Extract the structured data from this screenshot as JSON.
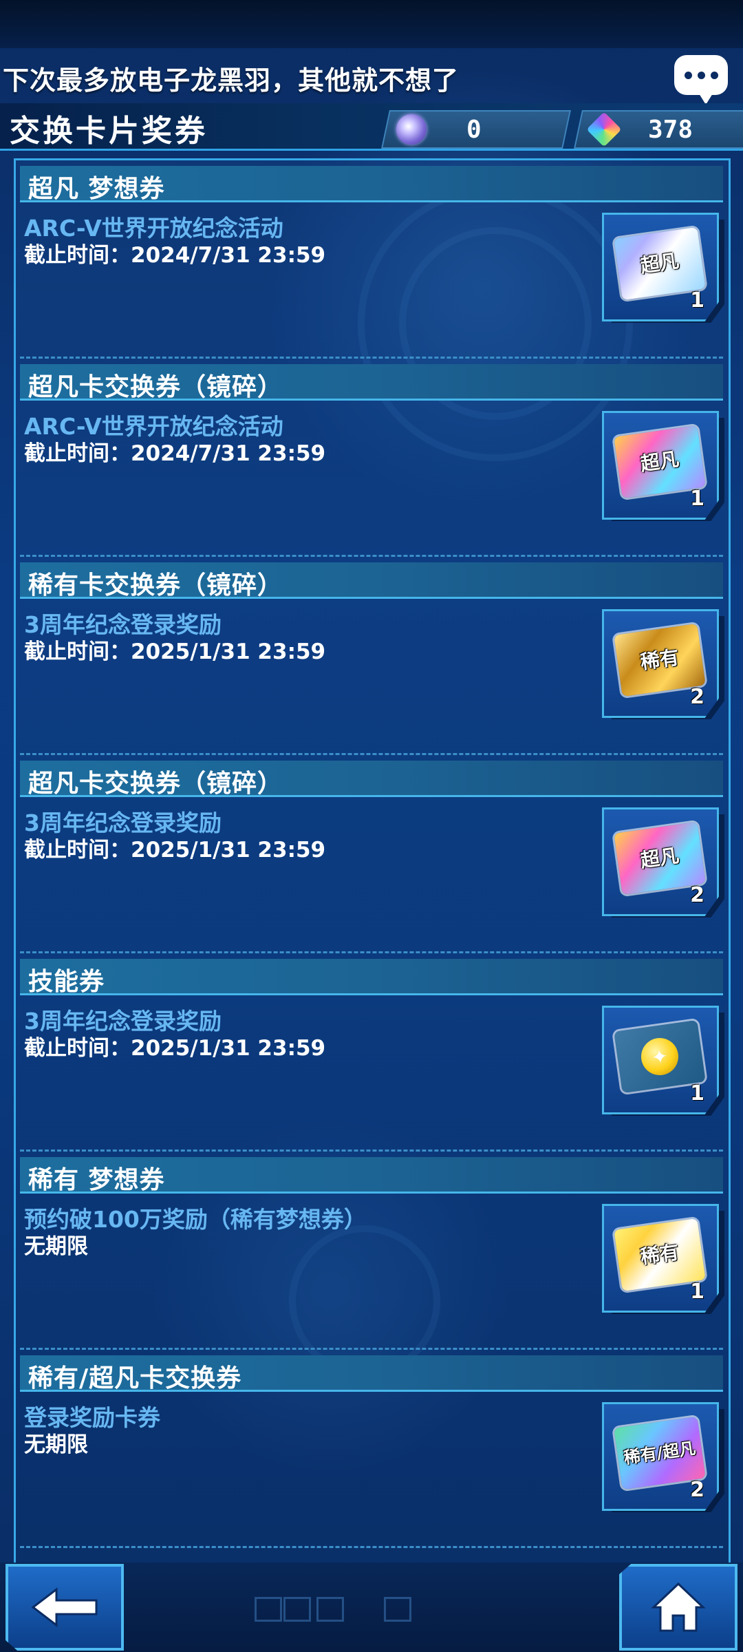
{
  "banner": {
    "text": "下次最多放电子龙黑羽，其他就不想了"
  },
  "header": {
    "title": "交换卡片奖券",
    "currencies": [
      {
        "icon": "orb-icon",
        "value": "0"
      },
      {
        "icon": "gem-icon",
        "value": "378"
      }
    ]
  },
  "tickets": [
    {
      "title": "超凡 梦想券",
      "event": "ARC-V世界开放纪念活动",
      "deadline": "截止时间：2024/7/31 23:59",
      "art_label": "超凡",
      "count": "1",
      "art": "dream"
    },
    {
      "title": "超凡卡交换券（镜碎）",
      "event": "ARC-V世界开放纪念活动",
      "deadline": "截止时间：2024/7/31 23:59",
      "art_label": "超凡",
      "count": "1",
      "art": "ultra"
    },
    {
      "title": "稀有卡交换券（镜碎）",
      "event": "3周年纪念登录奖励",
      "deadline": "截止时间：2025/1/31 23:59",
      "art_label": "稀有",
      "count": "2",
      "art": "rare"
    },
    {
      "title": "超凡卡交换券（镜碎）",
      "event": "3周年纪念登录奖励",
      "deadline": "截止时间：2025/1/31 23:59",
      "art_label": "超凡",
      "count": "2",
      "art": "ultra"
    },
    {
      "title": "技能券",
      "event": "3周年纪念登录奖励",
      "deadline": "截止时间：2025/1/31 23:59",
      "art_label": "",
      "count": "1",
      "art": "skill"
    },
    {
      "title": "稀有 梦想券",
      "event": "预约破100万奖励（稀有梦想券）",
      "deadline": "无期限",
      "art_label": "稀有",
      "count": "1",
      "art": "rare-dream"
    },
    {
      "title": "稀有/超凡卡交换券",
      "event": "登录奖励卡券",
      "deadline": "无期限",
      "art_label": "稀有/超凡",
      "count": "2",
      "art": "mix"
    }
  ],
  "nav": {
    "back_icon": "back-arrow-icon",
    "home_icon": "home-icon"
  }
}
